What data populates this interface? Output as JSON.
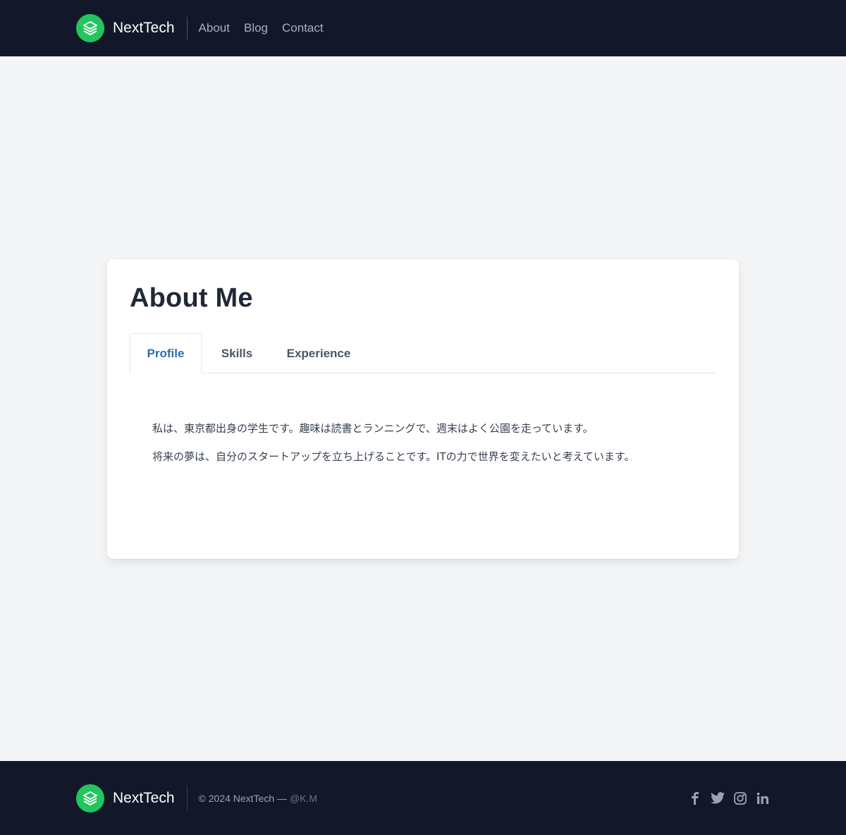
{
  "header": {
    "brand": "NextTech",
    "nav": [
      "About",
      "Blog",
      "Contact"
    ]
  },
  "card": {
    "title": "About Me",
    "tabs": [
      {
        "label": "Profile",
        "active": true
      },
      {
        "label": "Skills",
        "active": false
      },
      {
        "label": "Experience",
        "active": false
      }
    ],
    "paragraphs": [
      "私は、東京都出身の学生です。趣味は読書とランニングで、週末はよく公園を走っています。",
      "将来の夢は、自分のスタートアップを立ち上げることです。ITの力で世界を変えたいと考えています。"
    ]
  },
  "footer": {
    "brand": "NextTech",
    "copyright": "© 2024 NextTech — ",
    "handle": "@K.M",
    "social_icons": [
      "facebook-icon",
      "twitter-icon",
      "instagram-icon",
      "linkedin-icon"
    ]
  },
  "colors": {
    "header_bg": "#121829",
    "accent_green": "#22c55e",
    "active_tab": "#2b6cb0",
    "page_bg": "#f3f5f7"
  }
}
